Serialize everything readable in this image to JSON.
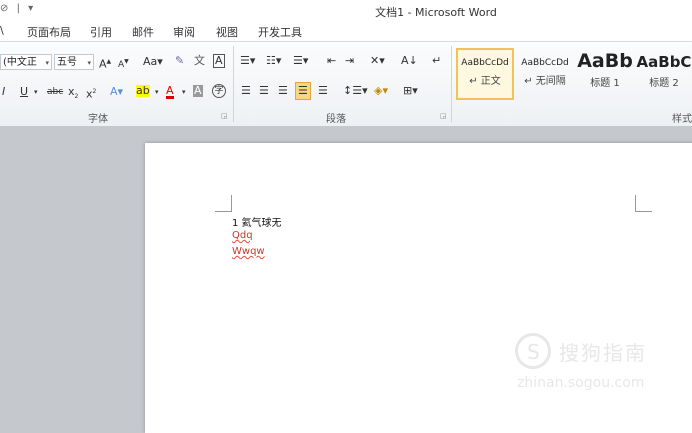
{
  "window": {
    "title": "文档1 - Microsoft Word"
  },
  "qat": {
    "items": [
      "⊘",
      "|",
      "▾"
    ]
  },
  "tabs": [
    {
      "label": "\\"
    },
    {
      "label": "页面布局"
    },
    {
      "label": "引用"
    },
    {
      "label": "邮件"
    },
    {
      "label": "审阅"
    },
    {
      "label": "视图"
    },
    {
      "label": "开发工具"
    }
  ],
  "font_group": {
    "font_name": "(中文正 ",
    "font_size": "五号",
    "label": "字体"
  },
  "paragraph_group": {
    "label": "段落"
  },
  "styles_group": {
    "label": "样式",
    "items": [
      {
        "sample": "AaBbCcDd",
        "name": "↵ 正文"
      },
      {
        "sample": "AaBbCcDd",
        "name": "↵ 无间隔"
      },
      {
        "sample": "AaBb",
        "name": "标题 1"
      },
      {
        "sample": "AaBbC",
        "name": "标题 2"
      }
    ]
  },
  "document": {
    "lines": [
      "1 氦气球无",
      "Qdq",
      "Wwqw"
    ]
  },
  "watermark": {
    "title": "搜狗指南",
    "url": "zhinan.sogou.com"
  }
}
